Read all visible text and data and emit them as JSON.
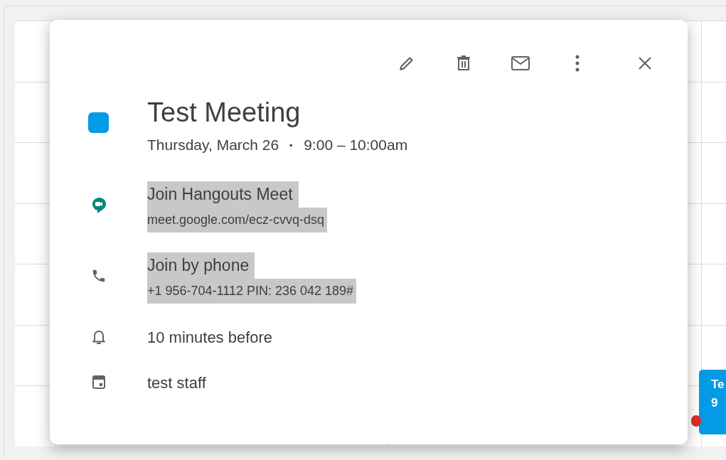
{
  "calendar_chip": {
    "title": "Te",
    "time": "9",
    "color": "#039be5"
  },
  "event": {
    "title": "Test Meeting",
    "color": "#039be5",
    "date": "Thursday, March 26",
    "separator": "·",
    "time": "9:00 – 10:00am"
  },
  "details": [
    {
      "kind": "meet",
      "title": "Join Hangouts Meet",
      "subtitle": "meet.google.com/ecz-cvvq-dsq",
      "highlighted": true
    },
    {
      "kind": "phone",
      "title": "Join by phone",
      "subtitle": "+1 956-704-1112 PIN: 236 042 189#",
      "highlighted": true
    },
    {
      "kind": "reminder",
      "text": "10 minutes before",
      "highlighted": false
    },
    {
      "kind": "calendar",
      "text": "test staff",
      "highlighted": false
    }
  ]
}
